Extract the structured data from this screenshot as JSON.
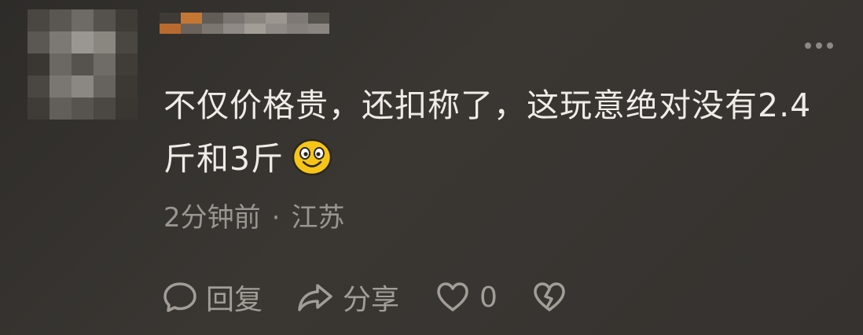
{
  "comment": {
    "text_line1": "不仅价格贵，还扣称了，这玩意绝对没有2.4",
    "text_line2": "斤和3斤",
    "emoji": "smiling-face-emoji",
    "time": "2分钟前",
    "separator": "·",
    "location": "江苏"
  },
  "actions": {
    "reply_label": "回复",
    "share_label": "分享",
    "like_count": "0"
  },
  "icons": [
    "more-icon",
    "reply-icon",
    "share-icon",
    "like-icon",
    "dislike-icon"
  ],
  "colors": {
    "background": "#35322f",
    "text": "#efece8",
    "meta": "#9a9590",
    "action": "#a29d97",
    "emoji": "#f5c518"
  }
}
